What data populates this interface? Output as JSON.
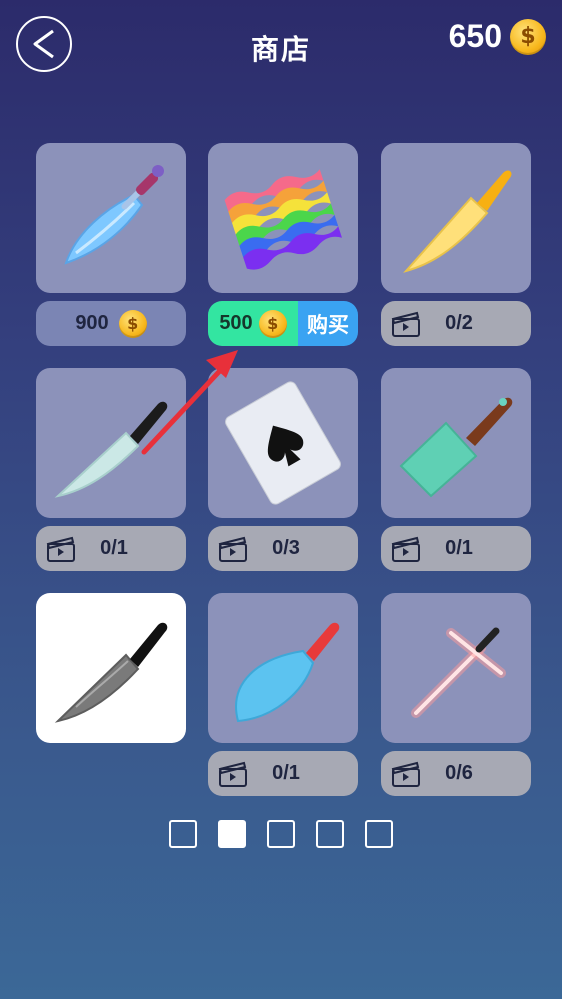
{
  "header": {
    "title": "商店",
    "coins": "650",
    "coin_symbol": "$"
  },
  "items": [
    {
      "name": "blue-dagger",
      "type": "price",
      "price": "900"
    },
    {
      "name": "rainbow-flag",
      "type": "buy",
      "price": "500",
      "buy_label": "购买"
    },
    {
      "name": "yellow-knife",
      "type": "video",
      "progress": "0/2"
    },
    {
      "name": "kitchen-knife",
      "type": "video",
      "progress": "0/1"
    },
    {
      "name": "spade-card",
      "type": "video",
      "progress": "0/3"
    },
    {
      "name": "teal-cleaver",
      "type": "video",
      "progress": "0/1"
    },
    {
      "name": "damascus-knife",
      "type": "selected"
    },
    {
      "name": "scale-blade",
      "type": "video",
      "progress": "0/1"
    },
    {
      "name": "red-lightsaber",
      "type": "video",
      "progress": "0/6"
    }
  ],
  "pager": {
    "pages": 5,
    "current": 2
  },
  "colors": {
    "buy_green": "#33e5a1",
    "buy_blue": "#3aa3f2",
    "arrow": "#e8303a"
  }
}
